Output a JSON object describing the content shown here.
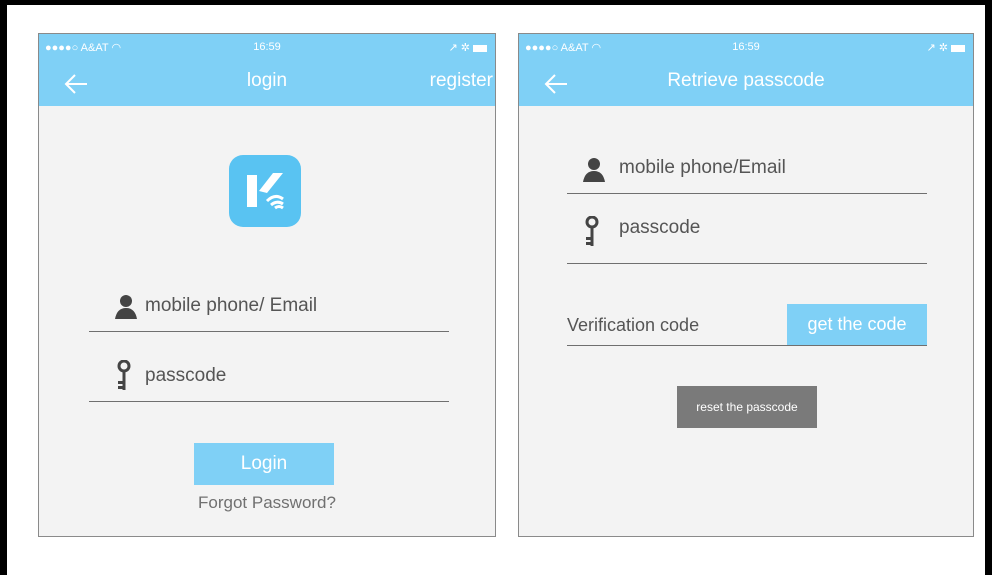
{
  "status_bar": {
    "carrier": "●●●●○  A&AT",
    "wifi": "wifi-icon",
    "time": "16:59",
    "right_icons": "location-icon bluetooth-icon battery-icon"
  },
  "login_screen": {
    "title": "login",
    "register_label": "register",
    "account_placeholder": "mobile phone/ Email",
    "password_placeholder": "passcode",
    "login_button": "Login",
    "forgot_link": "Forgot Password?"
  },
  "retrieve_screen": {
    "title": "Retrieve passcode",
    "account_placeholder": "mobile phone/Email",
    "password_placeholder": "passcode",
    "verification_label": "Verification code",
    "get_code_button": "get the code",
    "reset_button": "reset the passcode"
  },
  "colors": {
    "accent": "#7fd0f6",
    "app_icon": "#59c3f2",
    "background": "#f3f3f3",
    "gray_button": "#7a7a7a"
  }
}
